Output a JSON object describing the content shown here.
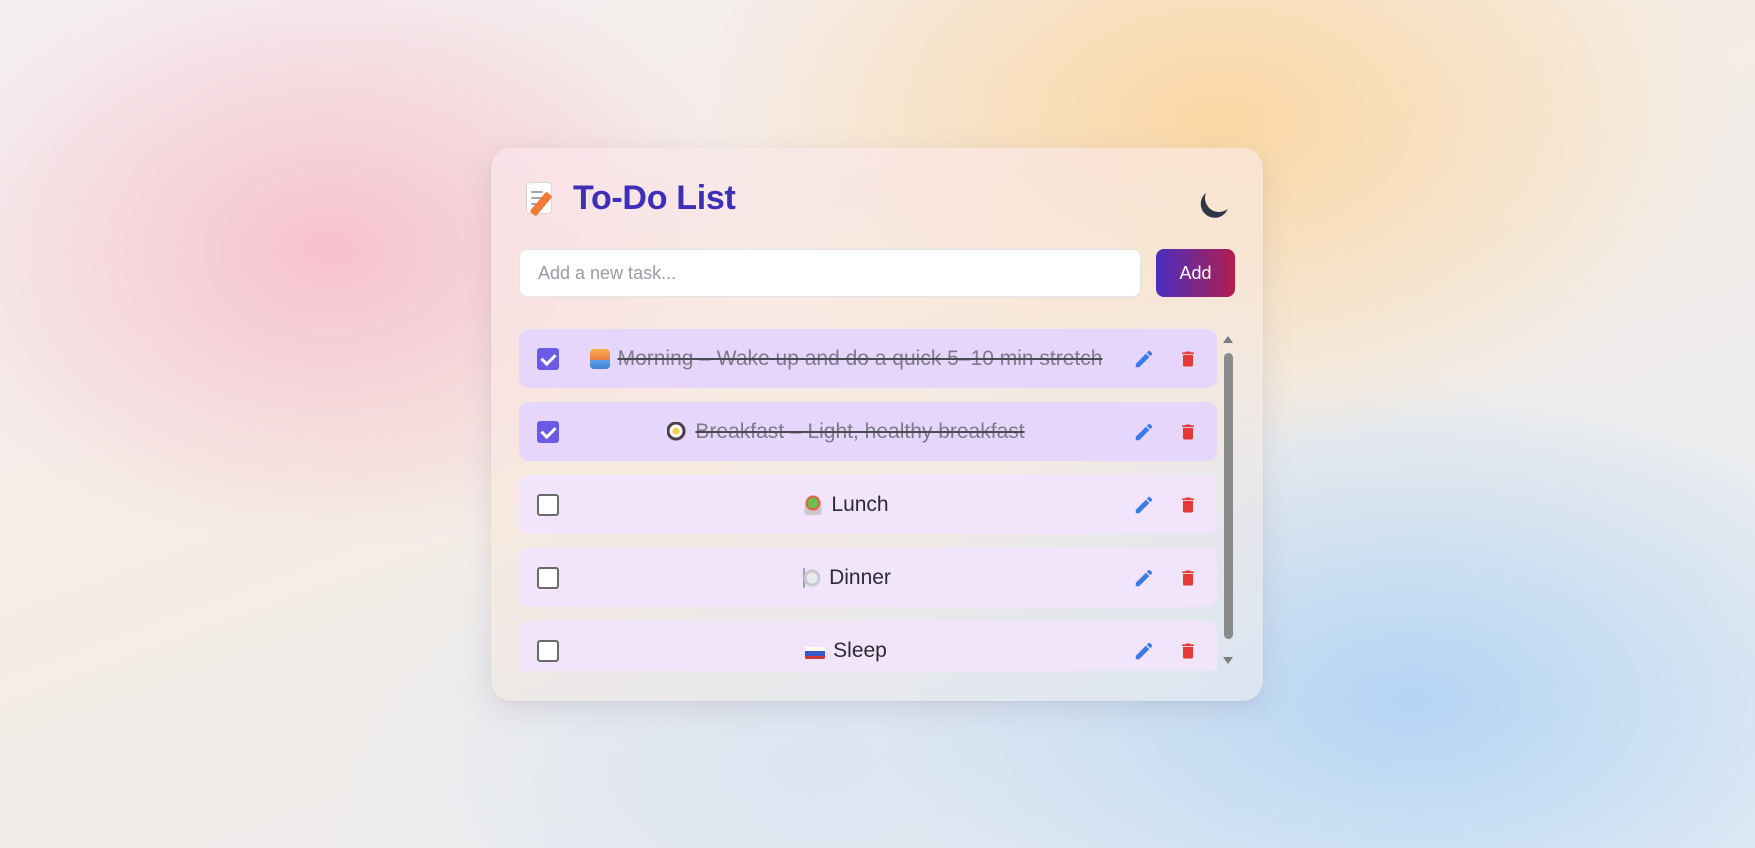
{
  "app": {
    "title": "To-Do List",
    "title_icon": "memo-icon",
    "theme_toggle_icon": "moon-icon"
  },
  "input": {
    "placeholder": "Add a new task...",
    "value": ""
  },
  "add_button": {
    "label": "Add"
  },
  "tasks": [
    {
      "emoji": "sunrise",
      "text": "Morning – Wake up and do a quick 5–10 min stretch",
      "completed": true
    },
    {
      "emoji": "frying-pan-egg",
      "text": "Breakfast – Light, healthy breakfast",
      "completed": true
    },
    {
      "emoji": "green-salad",
      "text": "Lunch",
      "completed": false
    },
    {
      "emoji": "fork-knife-plate",
      "text": "Dinner",
      "completed": false
    },
    {
      "emoji": "bed",
      "text": "Sleep",
      "completed": false
    }
  ],
  "actions": {
    "edit_icon": "pencil-icon",
    "delete_icon": "trash-icon"
  },
  "colors": {
    "title": "#3f2fb8",
    "add_gradient_start": "#4a2fc0",
    "add_gradient_end": "#b01e4e",
    "edit_icon": "#3b7be8",
    "delete_icon": "#e53935",
    "completed_row": "#e6d6fb",
    "open_row": "#f1e4fb",
    "checkbox_checked": "#6a5ae6"
  }
}
